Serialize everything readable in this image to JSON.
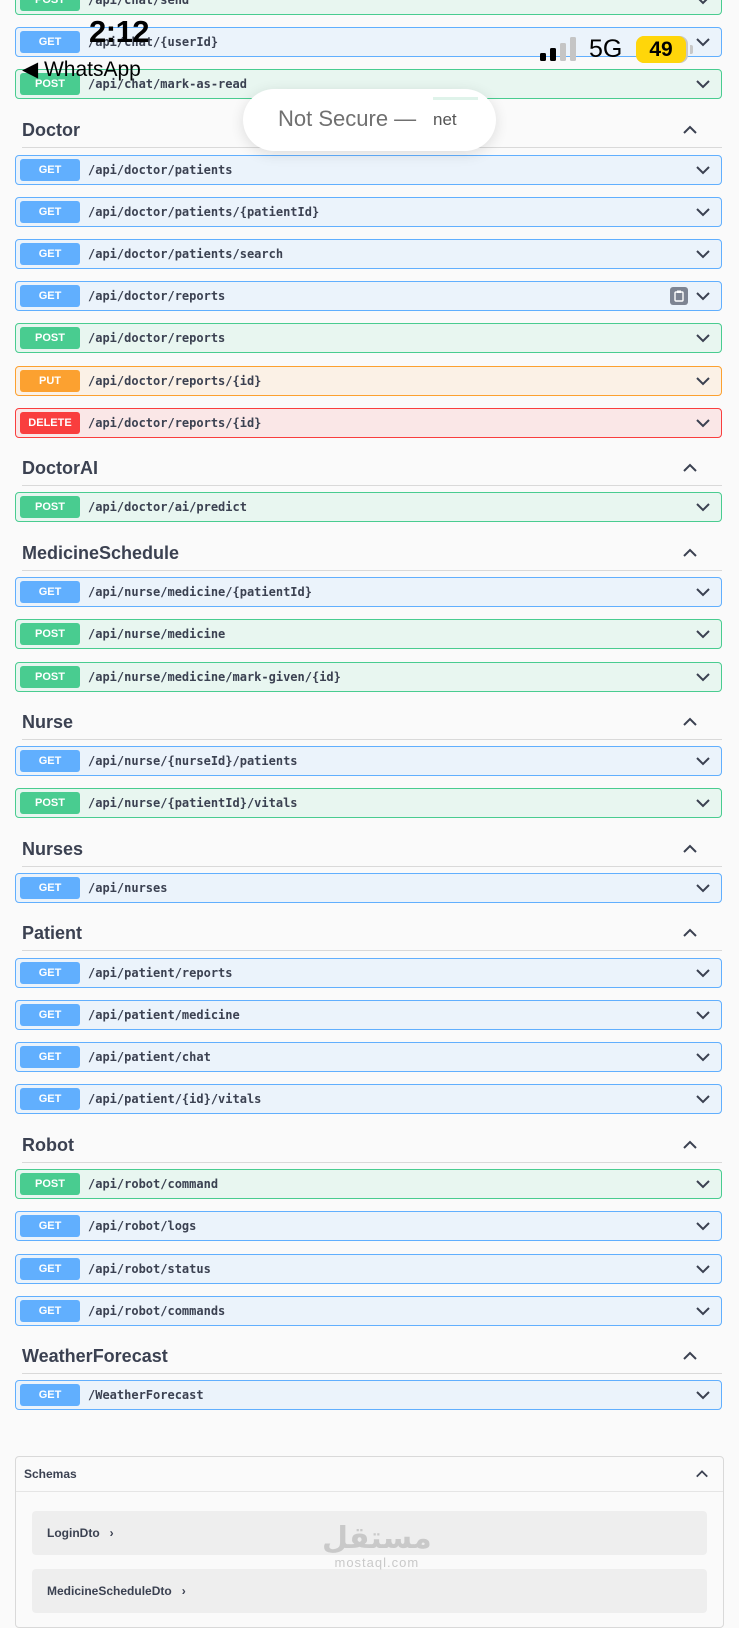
{
  "status_bar": {
    "time": "2:12",
    "back_label": "◀ WhatsApp",
    "network": "5G",
    "battery": "49"
  },
  "browser": {
    "url_text": "Not Secure —",
    "url_tail": "net"
  },
  "colors": {
    "get": "#61affe",
    "post": "#49cc90",
    "put": "#fca130",
    "delete": "#f93e3e"
  },
  "top_operations": [
    {
      "method": "POST",
      "path": "/api/chat/send"
    },
    {
      "method": "GET",
      "path": "/api/chat/{userId}"
    },
    {
      "method": "POST",
      "path": "/api/chat/mark-as-read"
    }
  ],
  "groups": [
    {
      "name": "Doctor",
      "operations": [
        {
          "method": "GET",
          "path": "/api/doctor/patients"
        },
        {
          "method": "GET",
          "path": "/api/doctor/patients/{patientId}"
        },
        {
          "method": "GET",
          "path": "/api/doctor/patients/search"
        },
        {
          "method": "GET",
          "path": "/api/doctor/reports"
        },
        {
          "method": "POST",
          "path": "/api/doctor/reports"
        },
        {
          "method": "PUT",
          "path": "/api/doctor/reports/{id}"
        },
        {
          "method": "DELETE",
          "path": "/api/doctor/reports/{id}"
        }
      ]
    },
    {
      "name": "DoctorAI",
      "operations": [
        {
          "method": "POST",
          "path": "/api/doctor/ai/predict"
        }
      ]
    },
    {
      "name": "MedicineSchedule",
      "operations": [
        {
          "method": "GET",
          "path": "/api/nurse/medicine/{patientId}"
        },
        {
          "method": "POST",
          "path": "/api/nurse/medicine"
        },
        {
          "method": "POST",
          "path": "/api/nurse/medicine/mark-given/{id}"
        }
      ]
    },
    {
      "name": "Nurse",
      "operations": [
        {
          "method": "GET",
          "path": "/api/nurse/{nurseId}/patients"
        },
        {
          "method": "POST",
          "path": "/api/nurse/{patientId}/vitals"
        }
      ]
    },
    {
      "name": "Nurses",
      "operations": [
        {
          "method": "GET",
          "path": "/api/nurses"
        }
      ]
    },
    {
      "name": "Patient",
      "operations": [
        {
          "method": "GET",
          "path": "/api/patient/reports"
        },
        {
          "method": "GET",
          "path": "/api/patient/medicine"
        },
        {
          "method": "GET",
          "path": "/api/patient/chat"
        },
        {
          "method": "GET",
          "path": "/api/patient/{id}/vitals"
        }
      ]
    },
    {
      "name": "Robot",
      "operations": [
        {
          "method": "POST",
          "path": "/api/robot/command"
        },
        {
          "method": "GET",
          "path": "/api/robot/logs"
        },
        {
          "method": "GET",
          "path": "/api/robot/status"
        },
        {
          "method": "GET",
          "path": "/api/robot/commands"
        }
      ]
    },
    {
      "name": "WeatherForecast",
      "operations": [
        {
          "method": "GET",
          "path": "/WeatherForecast"
        }
      ]
    }
  ],
  "schemas": {
    "title": "Schemas",
    "items": [
      "LoginDto",
      "MedicineScheduleDto"
    ]
  },
  "watermark": {
    "arabic": "مستقل",
    "latin": "mostaql.com"
  }
}
